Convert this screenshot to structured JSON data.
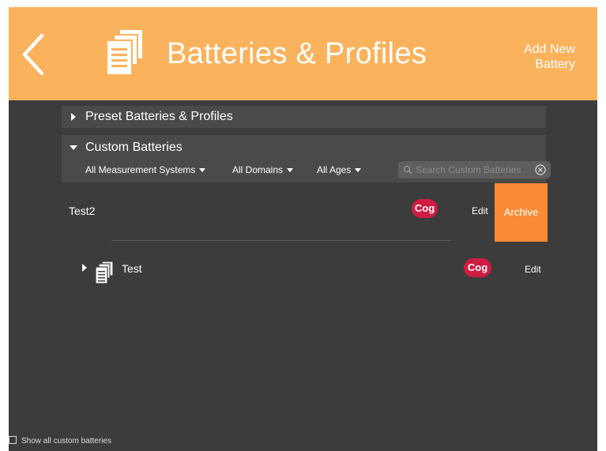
{
  "colors": {
    "header_bg": "#fbb25c",
    "screen_bg": "#3c3c3c",
    "section_bg": "#4a4a4a",
    "badge_bg": "#d01b43",
    "archive_bg": "#fb8b36"
  },
  "header": {
    "back_icon": "chevron-left-icon",
    "title_icon": "documents-icon",
    "title": "Batteries & Profiles",
    "add_new_line1": "Add New",
    "add_new_line2": "Battery"
  },
  "sections": {
    "preset_label": "Preset Batteries & Profiles",
    "custom_label": "Custom Batteries"
  },
  "filters": {
    "measurement": "All Measurement Systems",
    "domains": "All Domains",
    "ages": "All Ages"
  },
  "search": {
    "placeholder": "Search Custom Batteries",
    "value": ""
  },
  "rows": [
    {
      "name": "Test2",
      "badge": "Cog",
      "edit": "Edit",
      "archive": "Archive"
    },
    {
      "name": "Test",
      "badge": "Cog",
      "edit": "Edit",
      "icon": "documents-icon"
    }
  ],
  "footer": {
    "show_all_label": "Show all custom batteries",
    "show_all_checked": false
  }
}
